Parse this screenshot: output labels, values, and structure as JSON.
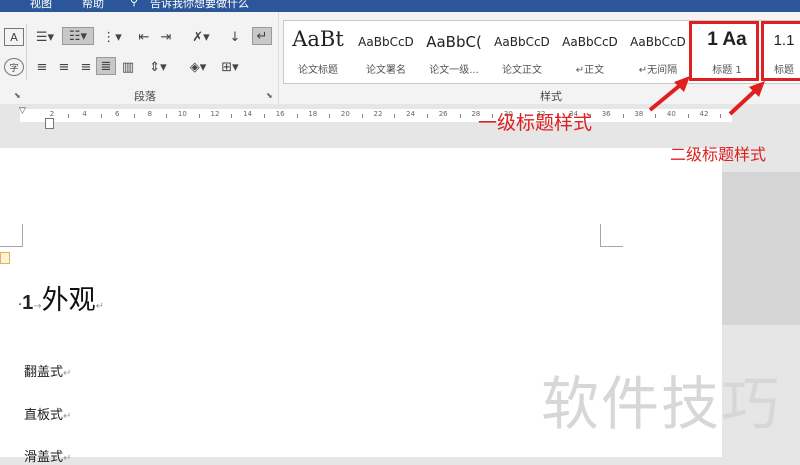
{
  "titlebar": {
    "menu_items": [
      "视图",
      "帮助"
    ],
    "tell_me": "告诉我你想要做什么"
  },
  "paragraph_group": {
    "label": "段落"
  },
  "styles_group": {
    "label": "样式",
    "styles": [
      {
        "preview": "AaBt",
        "name": "论文标题"
      },
      {
        "preview": "AaBbCcD",
        "name": "论文署名"
      },
      {
        "preview": "AaBbC(",
        "name": "论文一级..."
      },
      {
        "preview": "AaBbCcD",
        "name": "论文正文"
      },
      {
        "preview": "AaBbCcD",
        "name": "↵正文"
      },
      {
        "preview": "AaBbCcD",
        "name": "↵无间隔"
      },
      {
        "preview": "1 Aa",
        "name": "标题 1"
      },
      {
        "preview": "1.1",
        "name": "标题"
      }
    ]
  },
  "ruler": {
    "ticks": [
      "2",
      "4",
      "6",
      "8",
      "10",
      "12",
      "14",
      "16",
      "18",
      "20",
      "22",
      "24",
      "26",
      "28",
      "30",
      "32",
      "34",
      "36",
      "38",
      "40",
      "42"
    ]
  },
  "annotations": {
    "level1": "一级标题样式",
    "level2": "二级标题样式"
  },
  "document": {
    "heading_number": "1",
    "heading_text": "外观",
    "paragraphs": [
      "翻盖式",
      "直板式",
      "滑盖式"
    ],
    "para_mark": "↵"
  },
  "watermark": "软件技巧",
  "colors": {
    "title_bar": "#2b579a",
    "annotation_red": "#e02020",
    "ribbon_bg": "#f3f3f3"
  }
}
